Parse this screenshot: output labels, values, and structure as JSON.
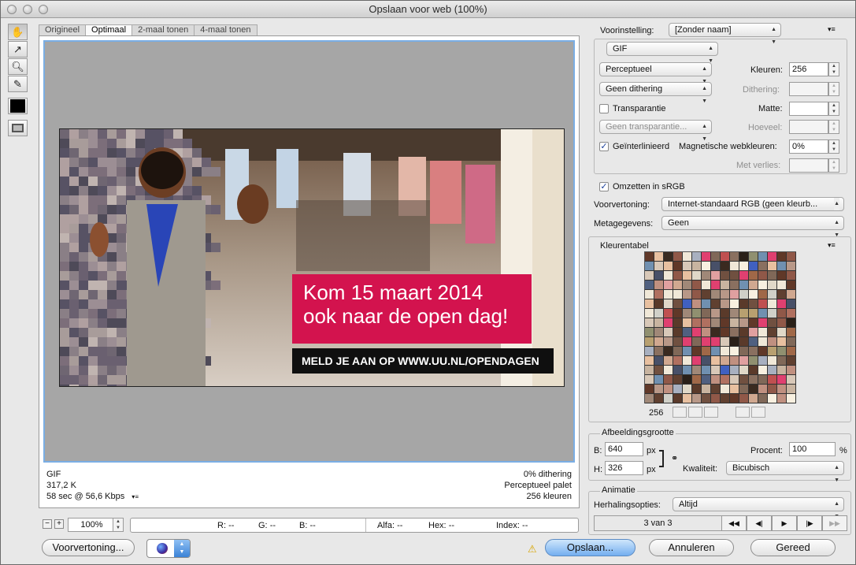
{
  "window": {
    "title": "Opslaan voor web (100%)"
  },
  "tabs": [
    "Origineel",
    "Optimaal",
    "2-maal tonen",
    "4-maal tonen"
  ],
  "banner": {
    "headline_line1": "Kom 15 maart 2014",
    "headline_line2": "ook naar de open dag!",
    "subline": "MELD JE AAN OP WWW.UU.NL/OPENDAGEN"
  },
  "preview_info": {
    "format": "GIF",
    "size": "317,2 K",
    "speed": "58 sec @ 56,6 Kbps",
    "dithering": "0% dithering",
    "palette": "Perceptueel palet",
    "colors": "256 kleuren"
  },
  "status": {
    "zoom": "100%",
    "r_label": "R:",
    "r_value": "--",
    "g_label": "G:",
    "g_value": "--",
    "b_label": "B:",
    "b_value": "--",
    "alfa_label": "Alfa:",
    "alfa_value": "--",
    "hex_label": "Hex:",
    "hex_value": "--",
    "index_label": "Index:",
    "index_value": "--"
  },
  "settings": {
    "preset_label": "Voorinstelling:",
    "preset_value": "[Zonder naam]",
    "format_value": "GIF",
    "reduction_value": "Perceptueel",
    "colors_label": "Kleuren:",
    "colors_value": "256",
    "dither_mode_value": "Geen dithering",
    "dither_label": "Dithering:",
    "dither_value": "",
    "transparency_label": "Transparantie",
    "transparency_checked": false,
    "matte_label": "Matte:",
    "matte_value": "",
    "transp_dither_value": "Geen transparantie...",
    "amount_label": "Hoeveel:",
    "amount_value": "",
    "interlaced_label": "Geïnterlinieerd",
    "interlaced_checked": true,
    "websnap_label": "Magnetische webkleuren:",
    "websnap_value": "0%",
    "lossy_label": "Met verlies:",
    "lossy_value": "",
    "srgb_label": "Omzetten in sRGB",
    "srgb_checked": true,
    "preview_label": "Voorvertoning:",
    "preview_value": "Internet-standaard RGB (geen kleurb...",
    "metadata_label": "Metagegevens:",
    "metadata_value": "Geen"
  },
  "color_table": {
    "title": "Kleurentabel",
    "count": "256"
  },
  "image_size": {
    "title": "Afbeeldingsgrootte",
    "w_label": "B:",
    "w_value": "640",
    "h_label": "H:",
    "h_value": "326",
    "unit": "px",
    "percent_label": "Procent:",
    "percent_value": "100",
    "percent_unit": "%",
    "quality_label": "Kwaliteit:",
    "quality_value": "Bicubisch"
  },
  "animation": {
    "title": "Animatie",
    "loop_label": "Herhalingsopties:",
    "loop_value": "Altijd",
    "frame_counter": "3 van 3"
  },
  "buttons": {
    "preview": "Voorvertoning...",
    "save": "Opslaan...",
    "cancel": "Annuleren",
    "done": "Gereed"
  },
  "colors": {
    "accent": "#d3134e",
    "selection": "#7aaee4"
  }
}
